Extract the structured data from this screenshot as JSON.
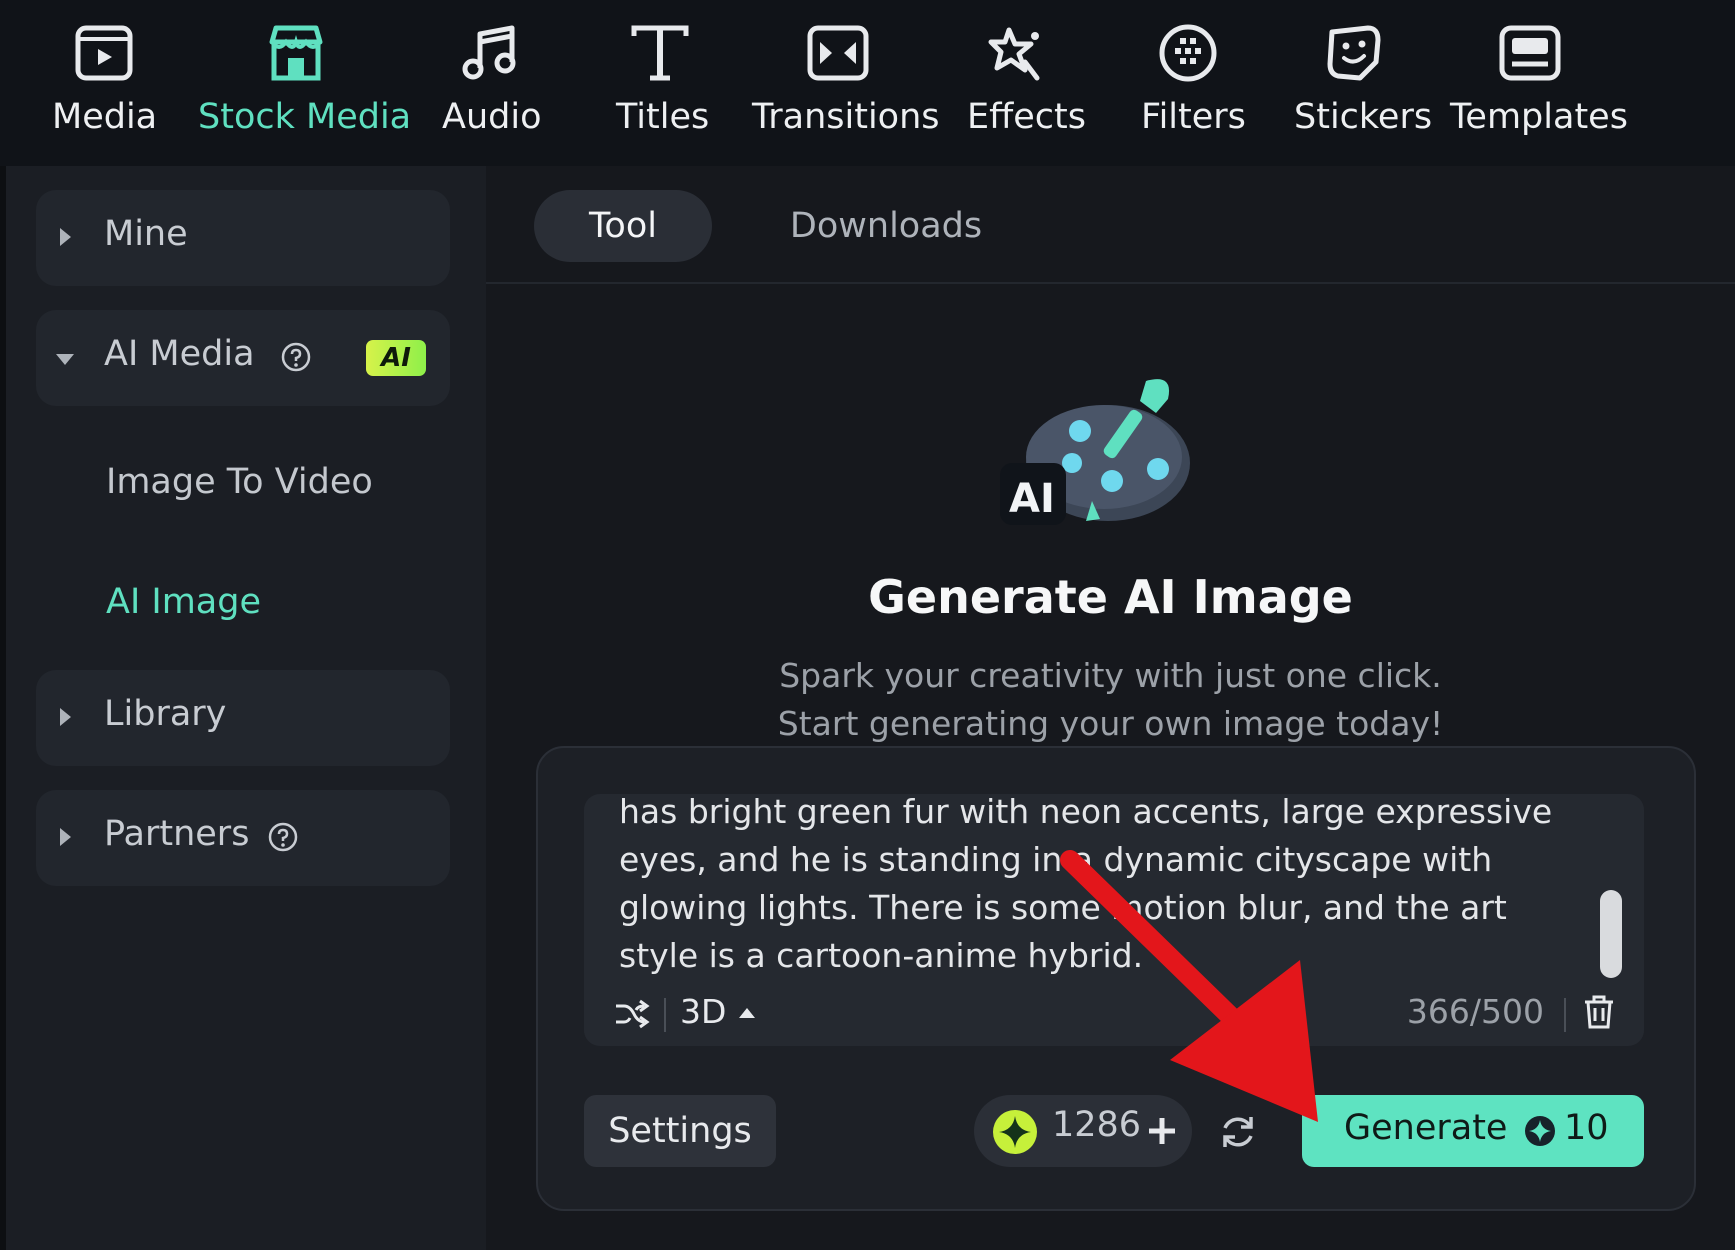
{
  "toolbar": {
    "items": [
      {
        "label": "Media",
        "icon": "media-icon"
      },
      {
        "label": "Stock Media",
        "icon": "stock-media-icon",
        "active": true
      },
      {
        "label": "Audio",
        "icon": "music-note-icon"
      },
      {
        "label": "Titles",
        "icon": "text-t-icon"
      },
      {
        "label": "Transitions",
        "icon": "transitions-icon"
      },
      {
        "label": "Effects",
        "icon": "effects-star-icon"
      },
      {
        "label": "Filters",
        "icon": "filters-icon"
      },
      {
        "label": "Stickers",
        "icon": "sticker-icon"
      },
      {
        "label": "Templates",
        "icon": "templates-icon"
      }
    ]
  },
  "sidebar": {
    "mine": "Mine",
    "ai_media": "AI Media",
    "ai_badge": "AI",
    "image_to_video": "Image To Video",
    "ai_image": "AI Image",
    "library": "Library",
    "partners": "Partners"
  },
  "tabs": {
    "tool": "Tool",
    "downloads": "Downloads"
  },
  "hero": {
    "badge": "AI",
    "title": "Generate AI Image",
    "subtitle_line1": "Spark your creativity with just one click.",
    "subtitle_line2": "Start generating your own image today!"
  },
  "prompt": {
    "text": "has bright green fur with neon accents, large expressive eyes, and he is standing in a dynamic cityscape with glowing lights. There is some motion blur, and the art style is a cartoon-anime hybrid.",
    "style": "3D",
    "counter": "366/500"
  },
  "actions": {
    "settings": "Settings",
    "credits": "1286",
    "generate": "Generate",
    "generate_cost": "10"
  },
  "colors": {
    "accent": "#5fe0c0",
    "annotation_arrow": "#e3161b"
  }
}
